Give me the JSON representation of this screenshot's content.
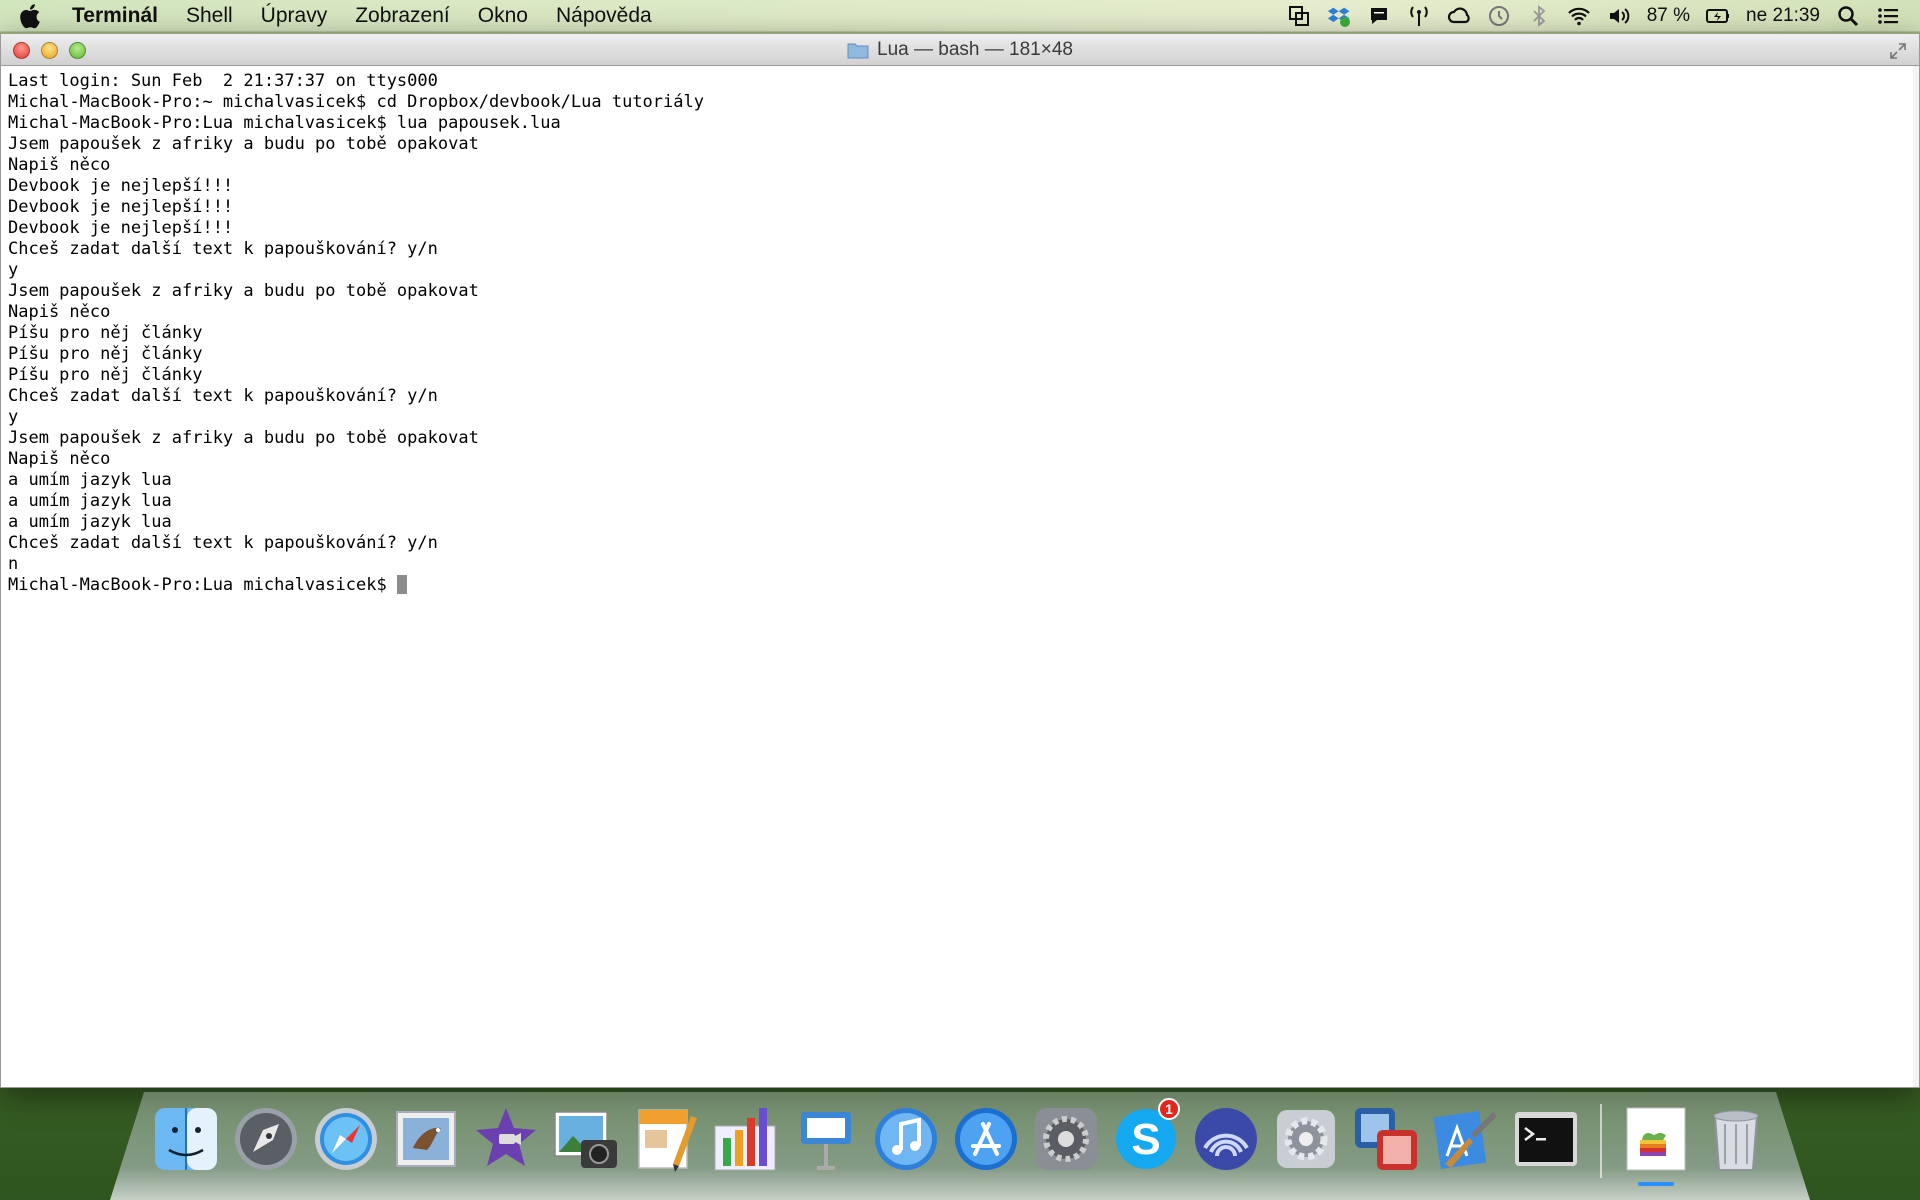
{
  "menubar": {
    "app_name": "Terminál",
    "items": [
      "Shell",
      "Úpravy",
      "Zobrazení",
      "Okno",
      "Nápověda"
    ],
    "battery_percent": "87 %",
    "clock": "ne 21:39"
  },
  "window": {
    "title": "Lua — bash — 181×48"
  },
  "terminal": {
    "lines": [
      "Last login: Sun Feb  2 21:37:37 on ttys000",
      "Michal-MacBook-Pro:~ michalvasicek$ cd Dropbox/devbook/Lua tutoriály",
      "Michal-MacBook-Pro:Lua michalvasicek$ lua papousek.lua",
      "Jsem papoušek z afriky a budu po tobě opakovat",
      "Napiš něco",
      "Devbook je nejlepší!!!",
      "Devbook je nejlepší!!!",
      "Devbook je nejlepší!!!",
      "Chceš zadat další text k papouškování? y/n",
      "y",
      "Jsem papoušek z afriky a budu po tobě opakovat",
      "Napiš něco",
      "Píšu pro něj články",
      "Píšu pro něj články",
      "Píšu pro něj články",
      "Chceš zadat další text k papouškování? y/n",
      "y",
      "Jsem papoušek z afriky a budu po tobě opakovat",
      "Napiš něco",
      "a umím jazyk lua",
      "a umím jazyk lua",
      "a umím jazyk lua",
      "Chceš zadat další text k papouškování? y/n",
      "n"
    ],
    "prompt": "Michal-MacBook-Pro:Lua michalvasicek$ "
  },
  "dock": {
    "skype_badge": "1",
    "apps": [
      "finder-icon",
      "launchpad-icon",
      "safari-icon",
      "mail-icon",
      "imovie-icon",
      "iphoto-icon",
      "pages-icon",
      "numbers-icon",
      "keynote-icon",
      "itunes-icon",
      "app-store-icon",
      "system-preferences-icon",
      "skype-icon",
      "torrent-icon",
      "utilities-gear-icon",
      "parallels-icon",
      "xcode-icon",
      "terminal-icon",
      "apple-logo-icon",
      "trash-icon"
    ]
  }
}
